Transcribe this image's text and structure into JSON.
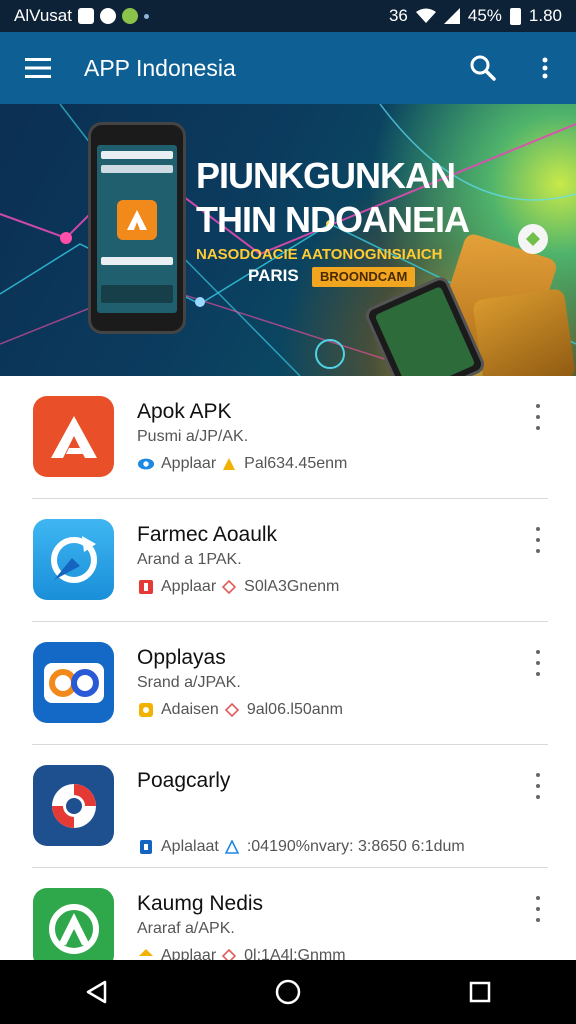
{
  "status_bar": {
    "carrier": "AlVusat",
    "signal_label": "36",
    "battery": "45%",
    "time": "1.80"
  },
  "app_bar": {
    "title": "APP Indonesia",
    "icons": [
      "menu-icon",
      "search-icon",
      "more-vert-icon"
    ],
    "background": "#0e5f94"
  },
  "banner": {
    "heading_line1": "PIUNKGUNKAN",
    "heading_line2": "THIN NDOANEIA",
    "sub_line": "NASODOACIE AATONOGNISIAICH",
    "sub_line2": "PARIS",
    "chip_label": "BROONDCAM"
  },
  "apps": [
    {
      "name": "Apok APK",
      "subtitle": "Pusmi a/JP/AK.",
      "category": "Applaar",
      "size": "Pal634.45enm",
      "icon_color": "#e9502a",
      "icon": "app-a-icon"
    },
    {
      "name": "Farmec Aoaulk",
      "subtitle": "Arand a 1PAK.",
      "category": "Applaar",
      "size": "S0lA3Gnenm",
      "icon_color": "#2aa7ec",
      "icon": "app-refresh-icon"
    },
    {
      "name": "Opplayas",
      "subtitle": "Srand a/JPAK.",
      "category": "Adaisen",
      "size": "9al06.l50anm",
      "icon_color": "#1569c6",
      "icon": "app-double-o-icon"
    },
    {
      "name": "Poagcarly",
      "subtitle": "",
      "category": "Aplalaat",
      "size": ":04190%nvary: 3:8650 6:1dum",
      "icon_color": "#1e4f8f",
      "icon": "app-swirl-icon"
    },
    {
      "name": "Kaumg Nedis",
      "subtitle": "Araraf a/APK.",
      "category": "Applaar",
      "size": "0l:1A4l;Gnmm",
      "icon_color": "#2ea84a",
      "icon": "app-green-a-icon"
    }
  ],
  "nav_bar": {
    "icons": [
      "back-icon",
      "home-icon",
      "recents-icon"
    ]
  }
}
